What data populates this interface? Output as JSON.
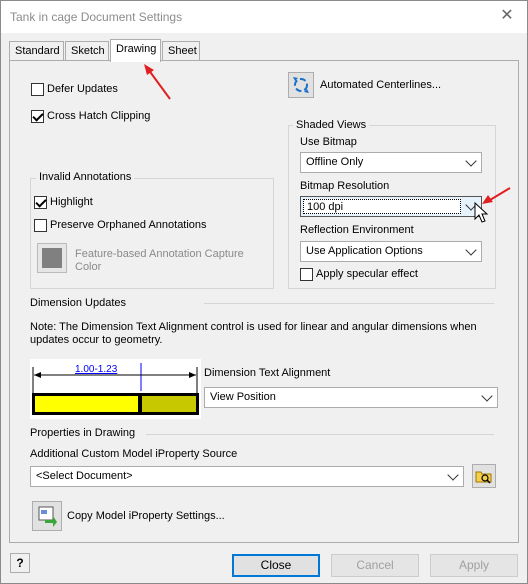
{
  "window": {
    "title": "Tank in cage Document Settings",
    "close_glyph": "✕"
  },
  "tabs": [
    {
      "label": "Standard"
    },
    {
      "label": "Sketch"
    },
    {
      "label": "Drawing"
    },
    {
      "label": "Sheet"
    }
  ],
  "drawing": {
    "defer_updates": {
      "label": "Defer Updates",
      "checked": false
    },
    "cross_hatch_clipping": {
      "label": "Cross Hatch Clipping",
      "checked": true
    },
    "automated_centerlines": {
      "label": "Automated Centerlines..."
    },
    "invalid_annotations": {
      "title": "Invalid Annotations",
      "highlight": {
        "label": "Highlight",
        "checked": true
      },
      "preserve_orphaned": {
        "label": "Preserve Orphaned Annotations",
        "checked": false
      },
      "capture_color_line1": "Feature-based Annotation Capture",
      "capture_color_line2": "Color",
      "swatch_color": "#808080"
    },
    "shaded_views": {
      "title": "Shaded Views",
      "use_bitmap_label": "Use Bitmap",
      "use_bitmap_value": "Offline Only",
      "bitmap_resolution_label": "Bitmap Resolution",
      "bitmap_resolution_value": "100 dpi",
      "reflection_label": "Reflection Environment",
      "reflection_value": "Use Application Options",
      "specular": {
        "label": "Apply specular effect",
        "checked": false
      }
    },
    "dimension_updates": {
      "title": "Dimension Updates",
      "note": "Note: The Dimension Text Alignment control is used for linear and angular dimensions when updates occur to geometry.",
      "preview_text": "1.00-1.23",
      "alignment_label": "Dimension Text Alignment",
      "alignment_value": "View Position",
      "preview_yellow": "#ffff00",
      "preview_olive": "#c8c800",
      "preview_blue": "#0000ff"
    },
    "properties": {
      "title": "Properties in Drawing",
      "source_label": "Additional Custom Model iProperty Source",
      "source_value": "<Select Document>",
      "copy_label": "Copy Model iProperty Settings..."
    }
  },
  "footer": {
    "help_glyph": "?",
    "close_label": "Close",
    "cancel_label": "Cancel",
    "apply_label": "Apply"
  },
  "annotation_color": "#e02020"
}
